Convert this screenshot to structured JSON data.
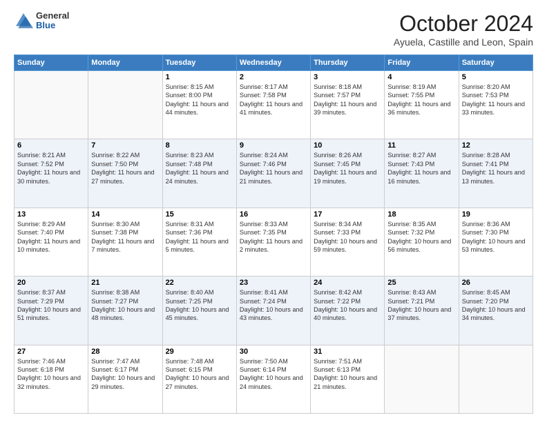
{
  "logo": {
    "general": "General",
    "blue": "Blue"
  },
  "header": {
    "month": "October 2024",
    "location": "Ayuela, Castille and Leon, Spain"
  },
  "days_of_week": [
    "Sunday",
    "Monday",
    "Tuesday",
    "Wednesday",
    "Thursday",
    "Friday",
    "Saturday"
  ],
  "weeks": [
    [
      {
        "day": null
      },
      {
        "day": null
      },
      {
        "day": "1",
        "sunrise": "Sunrise: 8:15 AM",
        "sunset": "Sunset: 8:00 PM",
        "daylight": "Daylight: 11 hours and 44 minutes."
      },
      {
        "day": "2",
        "sunrise": "Sunrise: 8:17 AM",
        "sunset": "Sunset: 7:58 PM",
        "daylight": "Daylight: 11 hours and 41 minutes."
      },
      {
        "day": "3",
        "sunrise": "Sunrise: 8:18 AM",
        "sunset": "Sunset: 7:57 PM",
        "daylight": "Daylight: 11 hours and 39 minutes."
      },
      {
        "day": "4",
        "sunrise": "Sunrise: 8:19 AM",
        "sunset": "Sunset: 7:55 PM",
        "daylight": "Daylight: 11 hours and 36 minutes."
      },
      {
        "day": "5",
        "sunrise": "Sunrise: 8:20 AM",
        "sunset": "Sunset: 7:53 PM",
        "daylight": "Daylight: 11 hours and 33 minutes."
      }
    ],
    [
      {
        "day": "6",
        "sunrise": "Sunrise: 8:21 AM",
        "sunset": "Sunset: 7:52 PM",
        "daylight": "Daylight: 11 hours and 30 minutes."
      },
      {
        "day": "7",
        "sunrise": "Sunrise: 8:22 AM",
        "sunset": "Sunset: 7:50 PM",
        "daylight": "Daylight: 11 hours and 27 minutes."
      },
      {
        "day": "8",
        "sunrise": "Sunrise: 8:23 AM",
        "sunset": "Sunset: 7:48 PM",
        "daylight": "Daylight: 11 hours and 24 minutes."
      },
      {
        "day": "9",
        "sunrise": "Sunrise: 8:24 AM",
        "sunset": "Sunset: 7:46 PM",
        "daylight": "Daylight: 11 hours and 21 minutes."
      },
      {
        "day": "10",
        "sunrise": "Sunrise: 8:26 AM",
        "sunset": "Sunset: 7:45 PM",
        "daylight": "Daylight: 11 hours and 19 minutes."
      },
      {
        "day": "11",
        "sunrise": "Sunrise: 8:27 AM",
        "sunset": "Sunset: 7:43 PM",
        "daylight": "Daylight: 11 hours and 16 minutes."
      },
      {
        "day": "12",
        "sunrise": "Sunrise: 8:28 AM",
        "sunset": "Sunset: 7:41 PM",
        "daylight": "Daylight: 11 hours and 13 minutes."
      }
    ],
    [
      {
        "day": "13",
        "sunrise": "Sunrise: 8:29 AM",
        "sunset": "Sunset: 7:40 PM",
        "daylight": "Daylight: 11 hours and 10 minutes."
      },
      {
        "day": "14",
        "sunrise": "Sunrise: 8:30 AM",
        "sunset": "Sunset: 7:38 PM",
        "daylight": "Daylight: 11 hours and 7 minutes."
      },
      {
        "day": "15",
        "sunrise": "Sunrise: 8:31 AM",
        "sunset": "Sunset: 7:36 PM",
        "daylight": "Daylight: 11 hours and 5 minutes."
      },
      {
        "day": "16",
        "sunrise": "Sunrise: 8:33 AM",
        "sunset": "Sunset: 7:35 PM",
        "daylight": "Daylight: 11 hours and 2 minutes."
      },
      {
        "day": "17",
        "sunrise": "Sunrise: 8:34 AM",
        "sunset": "Sunset: 7:33 PM",
        "daylight": "Daylight: 10 hours and 59 minutes."
      },
      {
        "day": "18",
        "sunrise": "Sunrise: 8:35 AM",
        "sunset": "Sunset: 7:32 PM",
        "daylight": "Daylight: 10 hours and 56 minutes."
      },
      {
        "day": "19",
        "sunrise": "Sunrise: 8:36 AM",
        "sunset": "Sunset: 7:30 PM",
        "daylight": "Daylight: 10 hours and 53 minutes."
      }
    ],
    [
      {
        "day": "20",
        "sunrise": "Sunrise: 8:37 AM",
        "sunset": "Sunset: 7:29 PM",
        "daylight": "Daylight: 10 hours and 51 minutes."
      },
      {
        "day": "21",
        "sunrise": "Sunrise: 8:38 AM",
        "sunset": "Sunset: 7:27 PM",
        "daylight": "Daylight: 10 hours and 48 minutes."
      },
      {
        "day": "22",
        "sunrise": "Sunrise: 8:40 AM",
        "sunset": "Sunset: 7:25 PM",
        "daylight": "Daylight: 10 hours and 45 minutes."
      },
      {
        "day": "23",
        "sunrise": "Sunrise: 8:41 AM",
        "sunset": "Sunset: 7:24 PM",
        "daylight": "Daylight: 10 hours and 43 minutes."
      },
      {
        "day": "24",
        "sunrise": "Sunrise: 8:42 AM",
        "sunset": "Sunset: 7:22 PM",
        "daylight": "Daylight: 10 hours and 40 minutes."
      },
      {
        "day": "25",
        "sunrise": "Sunrise: 8:43 AM",
        "sunset": "Sunset: 7:21 PM",
        "daylight": "Daylight: 10 hours and 37 minutes."
      },
      {
        "day": "26",
        "sunrise": "Sunrise: 8:45 AM",
        "sunset": "Sunset: 7:20 PM",
        "daylight": "Daylight: 10 hours and 34 minutes."
      }
    ],
    [
      {
        "day": "27",
        "sunrise": "Sunrise: 7:46 AM",
        "sunset": "Sunset: 6:18 PM",
        "daylight": "Daylight: 10 hours and 32 minutes."
      },
      {
        "day": "28",
        "sunrise": "Sunrise: 7:47 AM",
        "sunset": "Sunset: 6:17 PM",
        "daylight": "Daylight: 10 hours and 29 minutes."
      },
      {
        "day": "29",
        "sunrise": "Sunrise: 7:48 AM",
        "sunset": "Sunset: 6:15 PM",
        "daylight": "Daylight: 10 hours and 27 minutes."
      },
      {
        "day": "30",
        "sunrise": "Sunrise: 7:50 AM",
        "sunset": "Sunset: 6:14 PM",
        "daylight": "Daylight: 10 hours and 24 minutes."
      },
      {
        "day": "31",
        "sunrise": "Sunrise: 7:51 AM",
        "sunset": "Sunset: 6:13 PM",
        "daylight": "Daylight: 10 hours and 21 minutes."
      },
      {
        "day": null
      },
      {
        "day": null
      }
    ]
  ]
}
